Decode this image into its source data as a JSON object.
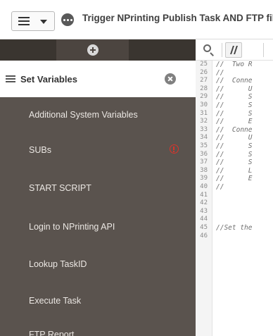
{
  "topbar": {
    "app_title": "Trigger NPrinting Publish Task AND FTP file"
  },
  "sidebar": {
    "active_section": "Set Variables",
    "items": [
      {
        "label": "Additional System Variables",
        "warning": false
      },
      {
        "label": "SUBs",
        "warning": true
      },
      {
        "label": "START SCRIPT",
        "warning": false
      },
      {
        "label": "Login to NPrinting API",
        "warning": false
      },
      {
        "label": "Lookup TaskID",
        "warning": false
      },
      {
        "label": "Execute Task",
        "warning": false
      },
      {
        "label": "FTP Report",
        "warning": false
      }
    ]
  },
  "editor": {
    "lines": [
      {
        "n": "25",
        "text": "//  Two R"
      },
      {
        "n": "26",
        "text": "//"
      },
      {
        "n": "27",
        "text": "//  Conne"
      },
      {
        "n": "28",
        "text": "//      U"
      },
      {
        "n": "29",
        "text": "//      S"
      },
      {
        "n": "30",
        "text": "//      S"
      },
      {
        "n": "31",
        "text": "//      S"
      },
      {
        "n": "32",
        "text": "//      E"
      },
      {
        "n": "33",
        "text": "//  Conne"
      },
      {
        "n": "34",
        "text": "//      U"
      },
      {
        "n": "35",
        "text": "//      S"
      },
      {
        "n": "36",
        "text": "//      S"
      },
      {
        "n": "37",
        "text": "//      S"
      },
      {
        "n": "38",
        "text": "//      L"
      },
      {
        "n": "39",
        "text": "//      E"
      },
      {
        "n": "40",
        "text": "//"
      },
      {
        "n": "41",
        "text": ""
      },
      {
        "n": "42",
        "text": ""
      },
      {
        "n": "43",
        "text": ""
      },
      {
        "n": "44",
        "text": ""
      },
      {
        "n": "45",
        "text": "//Set the"
      },
      {
        "n": "46",
        "text": ""
      }
    ]
  },
  "colors": {
    "sidebar_bg": "#5a534e",
    "sidebar_header_bg": "#3a3530",
    "warning": "#d9342b"
  }
}
